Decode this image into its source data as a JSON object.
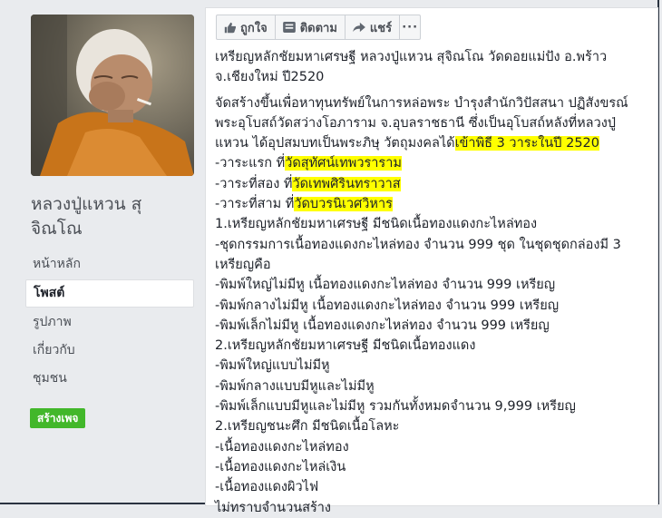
{
  "page": {
    "name_line1": "หลวงปู่แหวน สุ",
    "name_line2": "จิณโณ"
  },
  "nav": [
    {
      "label": "หน้าหลัก",
      "active": false
    },
    {
      "label": "โพสต์",
      "active": true
    },
    {
      "label": "รูปภาพ",
      "active": false
    },
    {
      "label": "เกี่ยวกับ",
      "active": false
    },
    {
      "label": "ชุมชน",
      "active": false
    }
  ],
  "create_page_label": "สร้างเพจ",
  "actions": {
    "like": "ถูกใจ",
    "follow": "ติดตาม",
    "share": "แชร์",
    "more": "···"
  },
  "post": {
    "p1_l1": "เหรียญหลักชัยมหาเศรษฐี หลวงปู่แหวน สุจิณโณ วัดดอยแม่ปัง อ.พร้าว",
    "p1_l2": "จ.เชียงใหม่ ปี2520",
    "p2_l1": "จัดสร้างขึ้นเพื่อหาทุนทรัพย์ในการหล่อพระ บำรุงสำนักวิปัสสนา ปฏิสังขรณ์",
    "p2_l2": "พระอุโบสถ์วัดสว่างโอภาราม จ.อุบลราชธานี ซึ่งเป็นอุโบสถ์หลังที่หลวงปู่",
    "p2_l3_a": "แหวน ได้อุปสมบทเป็นพระภิษุ วัตถุมงคลได้",
    "p2_l3_b": "เข้าพิธี 3 วาระในปี 2520",
    "r1_a": "-วาระแรก ที่",
    "r1_b": "วัดสุทัศน์เทพวราราม",
    "r2_a": "-วาระที่สอง ที่",
    "r2_b": "วัดเทพศิรินทราวาส",
    "r3_a": "-วาระที่สาม ที่",
    "r3_b": "วัดบวรนิเวศวิหาร",
    "lines": [
      "1.เหรียญหลักชัยมหาเศรษฐี มีชนิดเนื้อทองแดงกะไหล่ทอง",
      "-ชุดกรรมการเนื้อทองแดงกะไหล่ทอง จำนวน 999 ชุด ในชุดชุดกล่องมี 3",
      "เหรียญคือ",
      "-พิมพ์ใหญ่ไม่มีหู เนื้อทองแดงกะไหล่ทอง จำนวน 999 เหรียญ",
      "-พิมพ์กลางไม่มีหู เนื้อทองแดงกะไหล่ทอง จำนวน 999 เหรียญ",
      "-พิมพ์เล็กไม่มีหู เนื้อทองแดงกะไหล่ทอง จำนวน 999 เหรียญ",
      "2.เหรียญหลักชัยมหาเศรษฐี มีชนิดเนื้อทองแดง",
      "-พิมพ์ใหญ่แบบไม่มีหู",
      "-พิมพ์กลางแบบมีหูและไม่มีหู",
      "-พิมพ์เล็กแบบมีหูและไม่มีหู รวมกันทั้งหมดจำนวน 9,999 เหรียญ",
      "2.เหรียญชนะศึก มีชนิดเนื้อโลหะ",
      "-เนื้อทองแดงกะไหล่ทอง",
      "-เนื้อทองแดงกะไหล่เงิน",
      "-เนื้อทองแดงผิวไฟ",
      "ไม่ทราบจำนวนสร้าง"
    ]
  },
  "colors": {
    "background": "#e9ebee",
    "highlight": "#ffff00",
    "create_button": "#42b72a"
  }
}
